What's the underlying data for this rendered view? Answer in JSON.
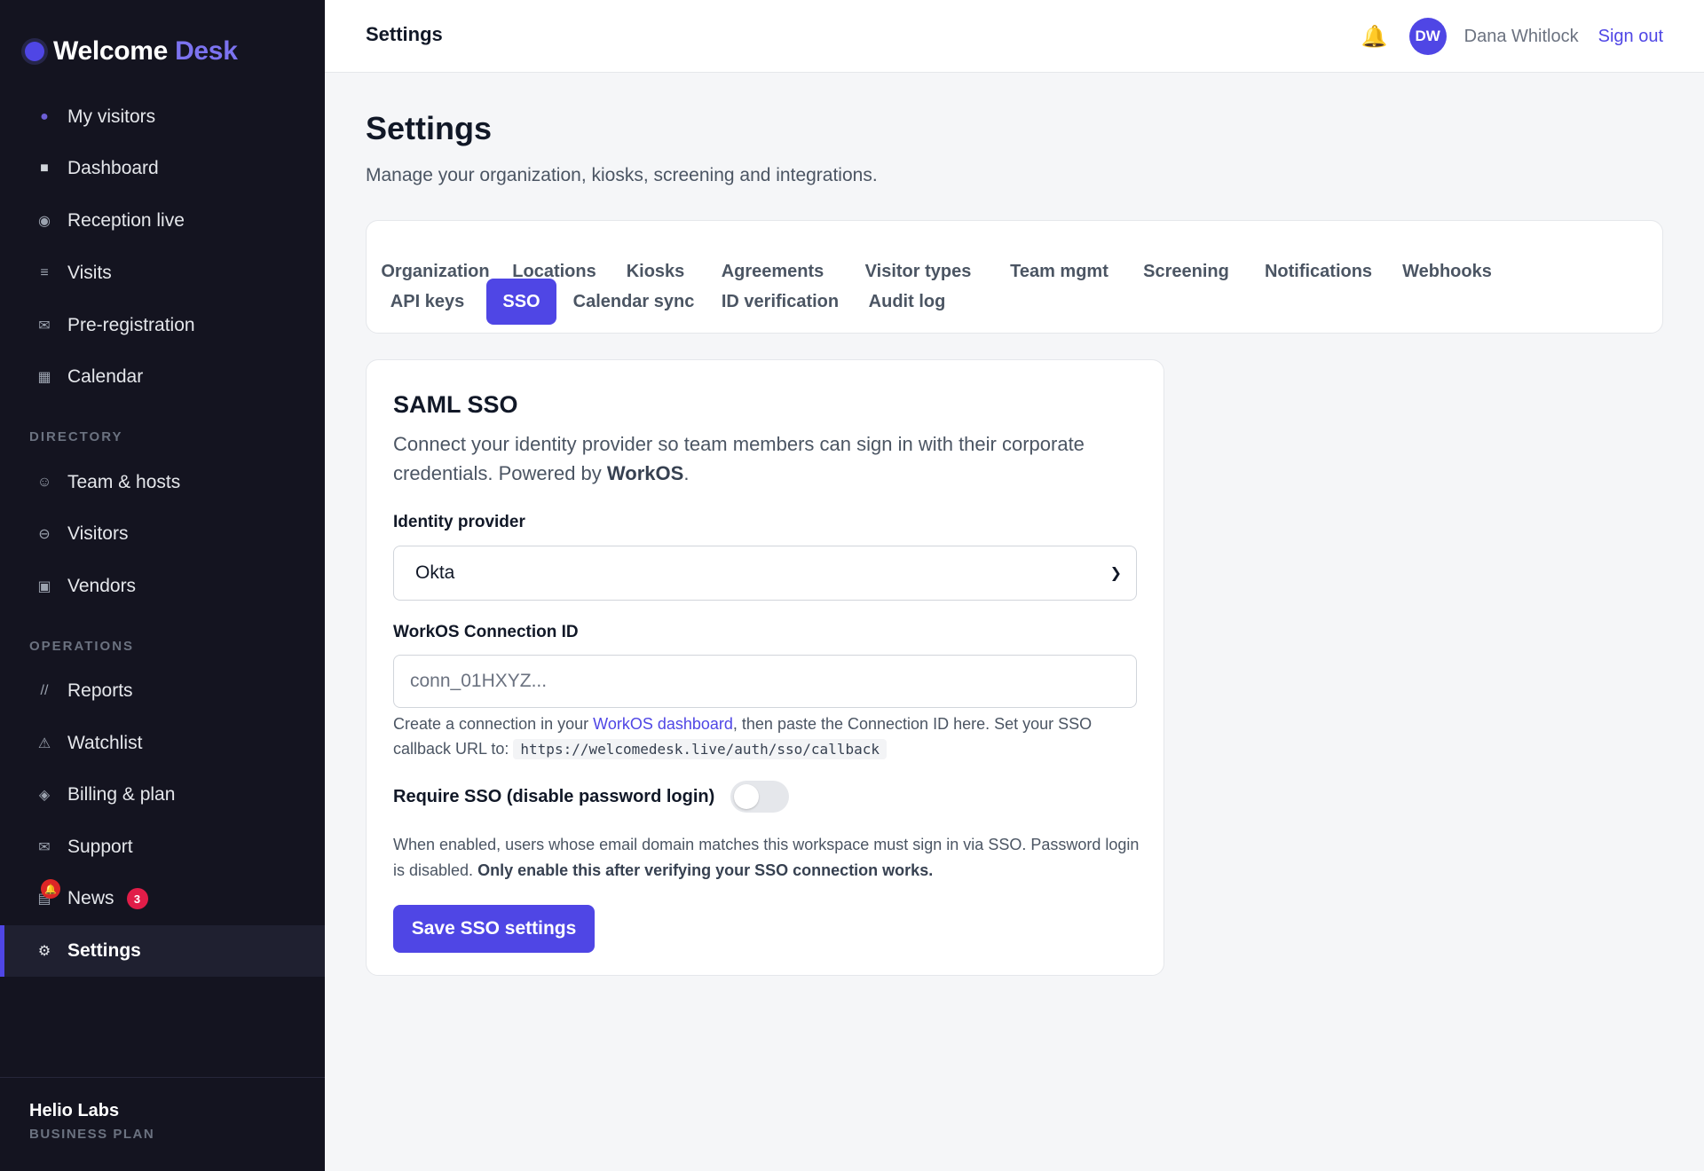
{
  "app": {
    "brand_primary": "Welcome",
    "brand_accent": "Desk",
    "accent_color": "#4f46e5"
  },
  "sidebar": {
    "items": [
      {
        "label": "My visitors",
        "icon": "person-icon"
      },
      {
        "label": "Dashboard",
        "icon": "square-icon"
      },
      {
        "label": "Reception live",
        "icon": "radio-icon"
      },
      {
        "label": "Visits",
        "icon": "list-icon"
      },
      {
        "label": "Pre-registration",
        "icon": "envelope-icon"
      },
      {
        "label": "Calendar",
        "icon": "calendar-icon"
      }
    ],
    "directory_heading": "DIRECTORY",
    "directory": [
      {
        "label": "Team & hosts",
        "icon": "smiley-icon"
      },
      {
        "label": "Visitors",
        "icon": "circle-icon"
      },
      {
        "label": "Vendors",
        "icon": "box-icon"
      }
    ],
    "operations_heading": "OPERATIONS",
    "operations": [
      {
        "label": "Reports",
        "icon": "chart-icon"
      },
      {
        "label": "Watchlist",
        "icon": "warning-icon"
      },
      {
        "label": "Billing & plan",
        "icon": "diamond-icon"
      },
      {
        "label": "Support",
        "icon": "envelope-icon"
      },
      {
        "label": "News",
        "icon": "newspaper-icon",
        "badge": "3"
      },
      {
        "label": "Settings",
        "icon": "gear-icon",
        "active": true
      }
    ],
    "footer": {
      "org_name": "Helio Labs",
      "plan": "BUSINESS PLAN"
    }
  },
  "topbar": {
    "title": "Settings",
    "avatar_initials": "DW",
    "user_name": "Dana Whitlock",
    "sign_out": "Sign out"
  },
  "page": {
    "title": "Settings",
    "subtitle": "Manage your organization, kiosks, screening and integrations."
  },
  "tabs": [
    "Organization",
    "Locations",
    "Kiosks",
    "Agreements",
    "Visitor types",
    "Team mgmt",
    "Screening",
    "Notifications",
    "Webhooks",
    "API keys",
    "SSO",
    "Calendar sync",
    "ID verification",
    "Audit log"
  ],
  "active_tab": "SSO",
  "sso": {
    "title": "SAML SSO",
    "desc_text": "Connect your identity provider so team members can sign in with their corporate credentials. Powered by",
    "desc_brand": "WorkOS",
    "desc_end": ".",
    "provider_label": "Identity provider",
    "provider_value": "Okta",
    "connection_label": "WorkOS Connection ID",
    "connection_placeholder": "conn_01HXYZ...",
    "help_prefix": "Create a connection in your",
    "help_link": "WorkOS dashboard",
    "help_middle": ", then paste the Connection ID here. Set your SSO callback URL to:",
    "callback_url": "https://welcomedesk.live/auth/sso/callback",
    "require_label": "Require SSO (disable password login)",
    "require_enabled": false,
    "note_text": "When enabled, users whose email domain matches this workspace must sign in via SSO. Password login is disabled.",
    "note_bold": "Only enable this after verifying your SSO connection works.",
    "save_label": "Save SSO settings"
  }
}
